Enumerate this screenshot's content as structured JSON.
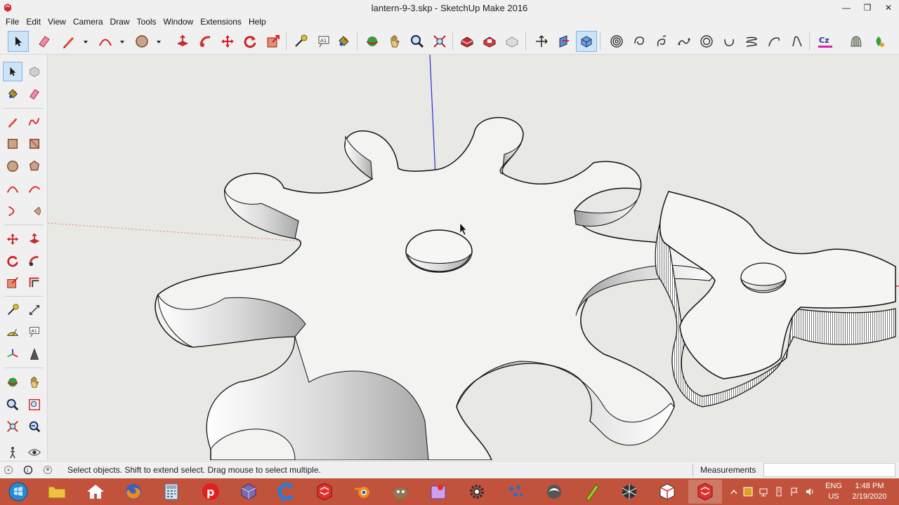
{
  "window": {
    "title": "lantern-9-3.skp - SketchUp Make 2016",
    "minimize_glyph": "—",
    "restore_glyph": "❐",
    "close_glyph": "✕"
  },
  "menu": [
    "File",
    "Edit",
    "View",
    "Camera",
    "Draw",
    "Tools",
    "Window",
    "Extensions",
    "Help"
  ],
  "toolbar": {
    "tools": [
      "select",
      "eraser",
      "line",
      "arc",
      "circle",
      "push-pull",
      "follow-me",
      "move",
      "rotate",
      "scale",
      "tape-measure",
      "text",
      "paint-bucket",
      "orbit",
      "pan",
      "zoom",
      "zoom-extents",
      "warehouse",
      "extension-warehouse",
      "layout",
      "axes",
      "section-plane",
      "x-ray",
      "spiral-1",
      "spiral-2",
      "spiral-3",
      "spiral-4",
      "spiral-5",
      "spiral-6",
      "spiral-7",
      "spiral-8",
      "spiral-9",
      "curve-plugin",
      "shape-plugin",
      "ruby-plugin"
    ],
    "active": "select"
  },
  "left_toolbar": {
    "active": "select",
    "tools": [
      "select",
      "make-component",
      "paint-bucket",
      "eraser",
      "line",
      "freehand",
      "rectangle",
      "rotated-rectangle",
      "circle",
      "polygon",
      "arc",
      "2-point-arc",
      "3-point-arc",
      "pie",
      "move",
      "push-pull",
      "rotate",
      "follow-me",
      "scale",
      "offset",
      "tape-measure",
      "dimensions",
      "protractor",
      "text",
      "axes",
      "3d-text",
      "orbit",
      "pan",
      "zoom",
      "zoom-window",
      "zoom-extents",
      "previous",
      "walk",
      "look-around"
    ]
  },
  "status": {
    "hint": "Select objects. Shift to extend select. Drag mouse to select multiple.",
    "measurements_label": "Measurements",
    "measurements_value": ""
  },
  "taskbar": {
    "apps": [
      "start",
      "file-explorer",
      "home",
      "firefox",
      "calculator",
      "ppt",
      "sketchup-cube",
      "ccleaner",
      "sketchup-2",
      "blender",
      "gimp",
      "paint",
      "settings",
      "dots",
      "inkscape",
      "pencil",
      "unity",
      "sketchup-3",
      "sketchup-active"
    ],
    "language": "ENG",
    "region": "US",
    "time": "1:48 PM",
    "date": "2/19/2020"
  },
  "colors": {
    "viewport_bg": "#e8e8e4",
    "axis_red": "#e02020",
    "axis_green": "#2ec02e",
    "axis_blue": "#2b2bd8",
    "taskbar": "#c1523b",
    "select_highlight": "#cde4f7"
  }
}
